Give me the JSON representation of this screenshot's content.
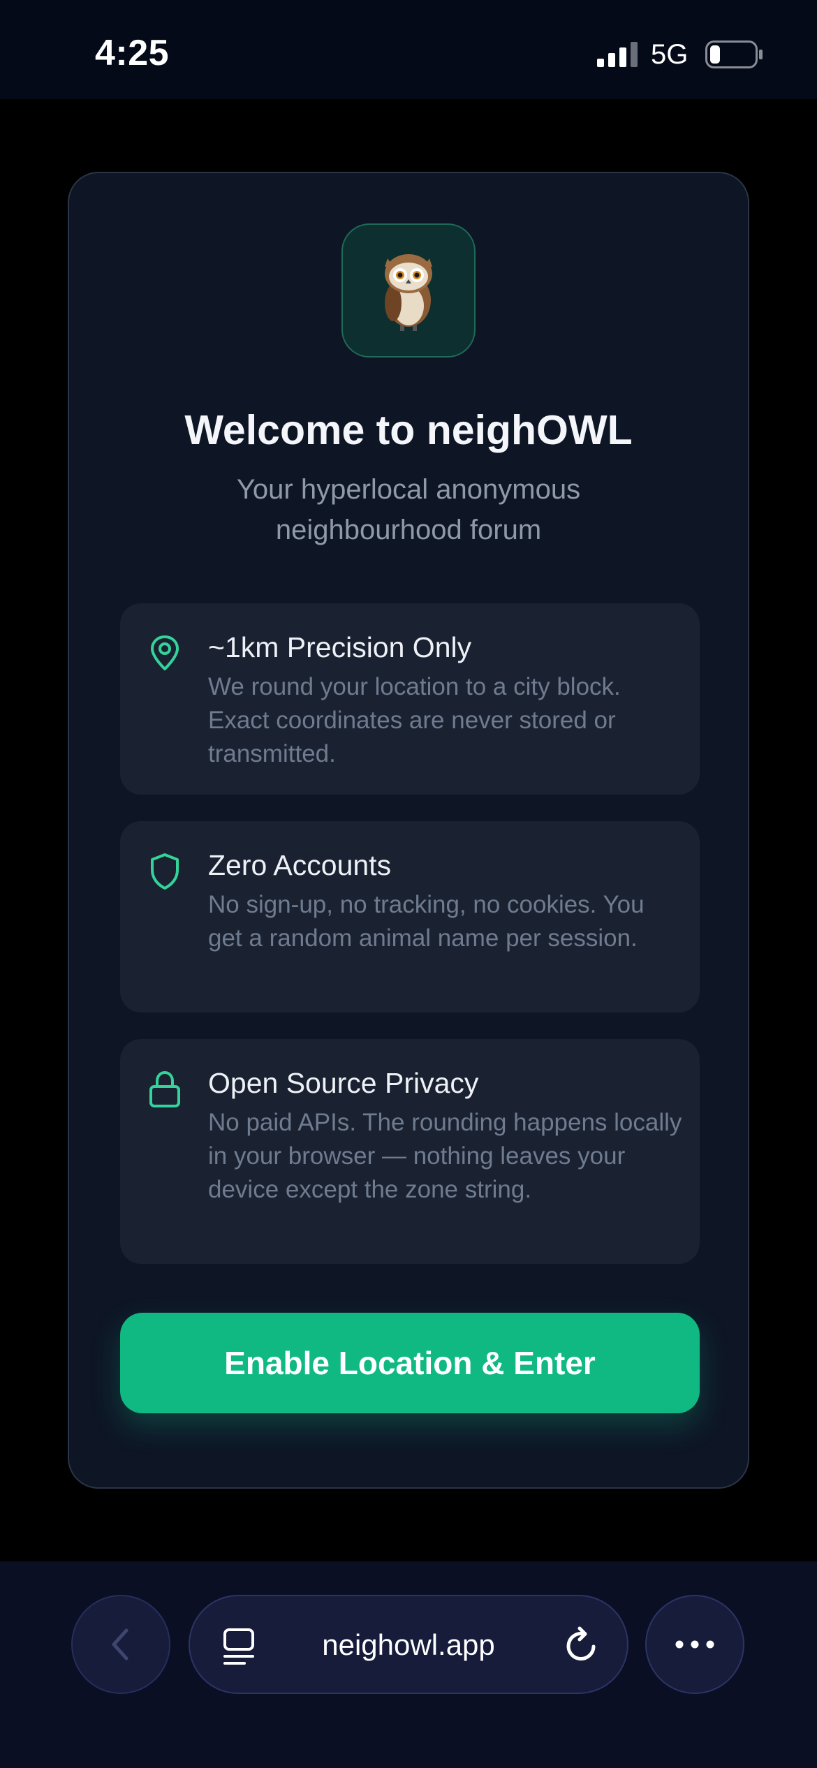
{
  "status_bar": {
    "time": "4:25",
    "network": "5G",
    "signal_icon": "cellular-signal-icon",
    "battery_icon": "battery-low-icon"
  },
  "welcome": {
    "logo_icon": "owl-icon",
    "title": "Welcome to neighOWL",
    "subtitle": "Your hyperlocal anonymous neighbourhood forum",
    "features": [
      {
        "icon": "map-pin-icon",
        "title": "~1km Precision Only",
        "description": "We round your location to a city block. Exact coordinates are never stored or transmitted."
      },
      {
        "icon": "shield-icon",
        "title": "Zero Accounts",
        "description": "No sign-up, no tracking, no cookies. You get a random animal name per session."
      },
      {
        "icon": "lock-icon",
        "title": "Open Source Privacy",
        "description": "No paid APIs. The rounding happens locally in your browser — nothing leaves your device except the zone string."
      }
    ],
    "enter_button_label": "Enable Location & Enter"
  },
  "browser": {
    "url": "neighowl.app",
    "back_icon": "chevron-left-icon",
    "tabs_icon": "tabs-icon",
    "reload_icon": "reload-icon",
    "more_icon": "more-dots-icon"
  },
  "colors": {
    "accent": "#10b981",
    "card_background": "#0e1626",
    "feature_background": "#1a2232",
    "page_background": "#000000"
  }
}
